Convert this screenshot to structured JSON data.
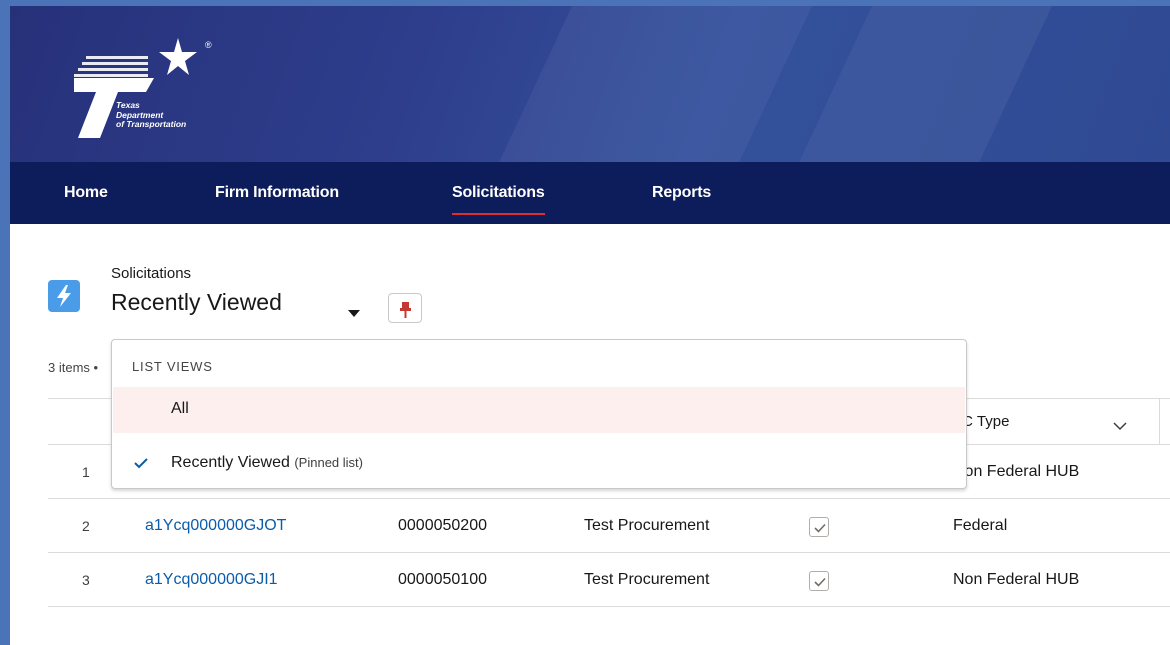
{
  "brand": {
    "logo_lines": [
      "Texas",
      "Department",
      "of Transportation"
    ],
    "registered_mark": "®"
  },
  "nav": {
    "items": [
      {
        "label": "Home",
        "active": false
      },
      {
        "label": "Firm Information",
        "active": false
      },
      {
        "label": "Solicitations",
        "active": true
      },
      {
        "label": "Reports",
        "active": false
      }
    ]
  },
  "header": {
    "object_label": "Solicitations",
    "list_view_title": "Recently Viewed",
    "icon": "lightning-icon",
    "pin_icon": "pin-icon"
  },
  "list": {
    "item_count": "3 items •",
    "visible_column_header": "TC Type",
    "rows": [
      {
        "num": "1",
        "record": "",
        "solicitation": "",
        "description": "",
        "checked": false,
        "type": "Non Federal HUB"
      },
      {
        "num": "2",
        "record": "a1Ycq000000GJOT",
        "solicitation": "0000050200",
        "description": "Test Procurement",
        "checked": true,
        "type": "Federal"
      },
      {
        "num": "3",
        "record": "a1Ycq000000GJI1",
        "solicitation": "0000050100",
        "description": "Test Procurement",
        "checked": true,
        "type": "Non Federal HUB"
      }
    ]
  },
  "dropdown": {
    "header": "LIST VIEWS",
    "items": [
      {
        "label": "All",
        "selected": false,
        "suffix": ""
      },
      {
        "label": "Recently Viewed",
        "selected": true,
        "suffix": "(Pinned list)"
      }
    ]
  },
  "colors": {
    "banner": "#2e3e8c",
    "navbar": "#0d1c5a",
    "active_underline": "#e02d2d",
    "link": "#0b5cab",
    "app_icon": "#4a9be8",
    "dropdown_highlight": "#fcefee"
  }
}
